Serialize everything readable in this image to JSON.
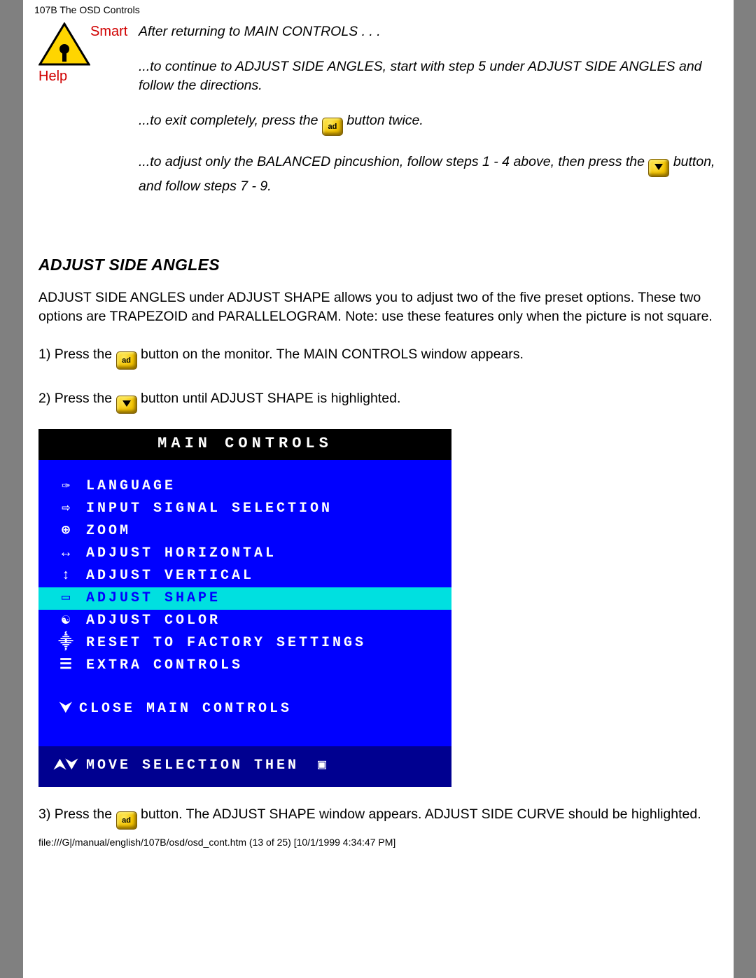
{
  "header": "107B The OSD Controls",
  "smart_help_label": "Smart Help",
  "intro": {
    "line0": "After returning to MAIN CONTROLS . . .",
    "line1a": "...to continue to ADJUST SIDE ANGLES, start with step 5 under ADJUST SIDE ANGLES and follow the directions.",
    "line2a": "...to exit completely, press the ",
    "line2b": " button twice.",
    "line3a": "...to adjust only the BALANCED pincushion, follow steps 1 - 4 above, then press the ",
    "line3b": " button, and follow steps 7 - 9."
  },
  "section_title": "ADJUST SIDE ANGLES",
  "section_body": "ADJUST SIDE ANGLES under ADJUST SHAPE allows you to adjust two of the five preset options. These two options are TRAPEZOID and PARALLELOGRAM. Note: use these features only when the picture is not square.",
  "step1a": "1) Press the ",
  "step1b": " button on the monitor. The MAIN CONTROLS window appears.",
  "step2a": "2) Press the ",
  "step2b": " button until ADJUST SHAPE is highlighted.",
  "step3a": "3) Press the ",
  "step3b": " button. The ADJUST SHAPE window appears. ADJUST SIDE CURVE should be highlighted.",
  "osd": {
    "title": "MAIN CONTROLS",
    "items": [
      {
        "icon": "language-icon",
        "glyph": "✑",
        "label": "LANGUAGE",
        "hl": false
      },
      {
        "icon": "input-signal-icon",
        "glyph": "⇨",
        "label": "INPUT SIGNAL SELECTION",
        "hl": false
      },
      {
        "icon": "zoom-icon",
        "glyph": "⊕",
        "label": "ZOOM",
        "hl": false
      },
      {
        "icon": "adjust-horizontal-icon",
        "glyph": "↔",
        "label": "ADJUST HORIZONTAL",
        "hl": false
      },
      {
        "icon": "adjust-vertical-icon",
        "glyph": "↕",
        "label": "ADJUST VERTICAL",
        "hl": false
      },
      {
        "icon": "adjust-shape-icon",
        "glyph": "▭",
        "label": "ADJUST SHAPE",
        "hl": true
      },
      {
        "icon": "adjust-color-icon",
        "glyph": "☯",
        "label": "ADJUST COLOR",
        "hl": false
      },
      {
        "icon": "factory-reset-icon",
        "glyph": "⸎",
        "label": "RESET TO FACTORY SETTINGS",
        "hl": false
      },
      {
        "icon": "extra-controls-icon",
        "glyph": "☰",
        "label": "EXTRA CONTROLS",
        "hl": false
      }
    ],
    "close_glyph": "⮟",
    "close_label": "CLOSE MAIN CONTROLS",
    "foot_glyph": "⮝⮟",
    "foot_label": "MOVE SELECTION THEN",
    "foot_ok": "▣"
  },
  "ok_button_text": "ad",
  "footer": "file:///G|/manual/english/107B/osd/osd_cont.htm (13 of 25) [10/1/1999 4:34:47 PM]"
}
